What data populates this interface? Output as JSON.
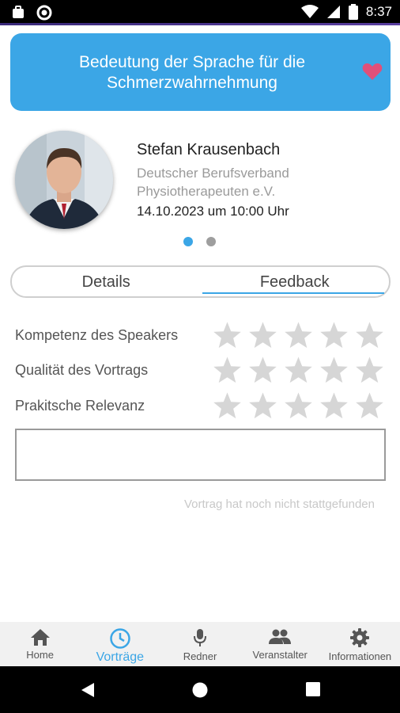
{
  "status_bar": {
    "time": "8:37",
    "icons": [
      "briefcase-icon",
      "record-icon",
      "wifi-icon",
      "signal-icon",
      "battery-icon"
    ]
  },
  "talk": {
    "title": "Bedeutung der Sprache für die Schmerzwahrnehmung",
    "favorite": true
  },
  "speaker": {
    "name": "Stefan Krausenbach",
    "organization": "Deutscher Berufsverband Physiotherapeuten e.V.",
    "datetime": "14.10.2023 um 10:00 Uhr"
  },
  "pager": {
    "pages": 2,
    "active": 0
  },
  "tabs": [
    {
      "label": "Details",
      "active": false
    },
    {
      "label": "Feedback",
      "active": true
    }
  ],
  "ratings": [
    {
      "label": "Kompetenz des Speakers",
      "stars": 0,
      "max": 5
    },
    {
      "label": "Qualität des Vortrags",
      "stars": 0,
      "max": 5
    },
    {
      "label": "Prakitsche Relevanz",
      "stars": 0,
      "max": 5
    }
  ],
  "feedback": {
    "comment": "",
    "notice": "Vortrag hat noch nicht stattgefunden"
  },
  "bottom_nav": [
    {
      "label": "Home",
      "icon": "home-icon",
      "active": false
    },
    {
      "label": "Vorträge",
      "icon": "clock-icon",
      "active": true
    },
    {
      "label": "Redner",
      "icon": "microphone-icon",
      "active": false
    },
    {
      "label": "Veranstalter",
      "icon": "people-icon",
      "active": false
    },
    {
      "label": "Informationen",
      "icon": "gear-icon",
      "active": false
    }
  ],
  "colors": {
    "accent": "#3ba6e6",
    "heart": "#e0507a",
    "star_empty": "#d6d6d6"
  }
}
